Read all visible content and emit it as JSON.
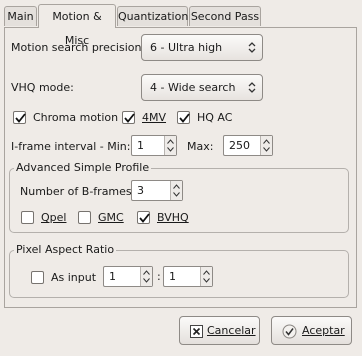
{
  "tabs": [
    {
      "label": "Main"
    },
    {
      "label": "Motion & Misc",
      "active": true
    },
    {
      "label": "Quantization"
    },
    {
      "label": "Second Pass"
    }
  ],
  "motion": {
    "precision_label": "Motion search precision:",
    "precision_value": "6 - Ultra high",
    "vhq_label": "VHQ mode:",
    "vhq_value": "4 - Wide search"
  },
  "options": {
    "chroma_motion": {
      "label": "Chroma motion",
      "checked": true
    },
    "fourmv": {
      "label": "4MV",
      "checked": true
    },
    "hqac": {
      "label": "HQ AC",
      "checked": true
    }
  },
  "iframe": {
    "min_label": "I-frame interval - Min:",
    "min_value": "1",
    "max_label": "Max:",
    "max_value": "250"
  },
  "asp": {
    "title": "Advanced Simple Profile",
    "bframes_label": "Number of B-frames:",
    "bframes_value": "3",
    "qpel": {
      "label": "Qpel",
      "checked": false
    },
    "gmc": {
      "label": "GMC",
      "checked": false
    },
    "bvhq": {
      "label": "BVHQ",
      "checked": true
    }
  },
  "par": {
    "title": "Pixel Aspect Ratio",
    "as_input": {
      "label": "As input",
      "checked": false
    },
    "num": "1",
    "den": "1",
    "sep": ":"
  },
  "buttons": {
    "cancel": "Cancelar",
    "accept": "Aceptar"
  }
}
